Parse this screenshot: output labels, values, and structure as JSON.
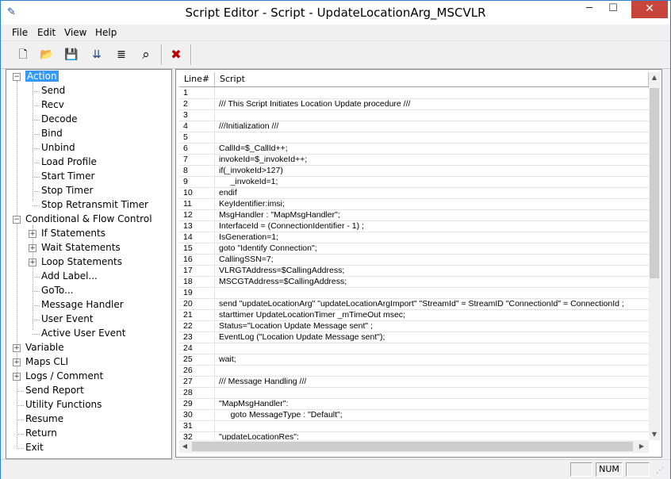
{
  "window": {
    "title": "Script Editor - Script - UpdateLocationArg_MSCVLR",
    "minimize": "─",
    "maximize": "☐",
    "close": "✕"
  },
  "menu": [
    "File",
    "Edit",
    "View",
    "Help"
  ],
  "toolbar": {
    "buttons": [
      {
        "name": "new-icon",
        "glyph": "🗋"
      },
      {
        "name": "open-folder-icon",
        "glyph": "📂"
      },
      {
        "name": "save-icon",
        "glyph": "💾"
      },
      {
        "name": "insert-icon",
        "glyph": "⇊"
      },
      {
        "name": "indent-icon",
        "glyph": "≣"
      },
      {
        "name": "find-icon",
        "glyph": "⌕"
      },
      {
        "name": "delete-icon",
        "glyph": "✖"
      }
    ]
  },
  "tree": {
    "items": [
      {
        "label": "Action",
        "level": 0,
        "expander": "−",
        "selected": true
      },
      {
        "label": "Send",
        "level": 1
      },
      {
        "label": "Recv",
        "level": 1
      },
      {
        "label": "Decode",
        "level": 1
      },
      {
        "label": "Bind",
        "level": 1
      },
      {
        "label": "Unbind",
        "level": 1
      },
      {
        "label": "Load Profile",
        "level": 1
      },
      {
        "label": "Start Timer",
        "level": 1
      },
      {
        "label": "Stop Timer",
        "level": 1
      },
      {
        "label": "Stop Retransmit Timer",
        "level": 1
      },
      {
        "label": "Conditional & Flow Control",
        "level": 0,
        "expander": "−"
      },
      {
        "label": "If Statements",
        "level": 1,
        "expander": "+"
      },
      {
        "label": "Wait Statements",
        "level": 1,
        "expander": "+"
      },
      {
        "label": "Loop Statements",
        "level": 1,
        "expander": "+"
      },
      {
        "label": "Add Label...",
        "level": 1
      },
      {
        "label": "GoTo...",
        "level": 1
      },
      {
        "label": "Message Handler",
        "level": 1
      },
      {
        "label": "User Event",
        "level": 1
      },
      {
        "label": "Active User Event",
        "level": 1
      },
      {
        "label": "Variable",
        "level": 0,
        "expander": "+"
      },
      {
        "label": "Maps CLI",
        "level": 0,
        "expander": "+"
      },
      {
        "label": "Logs / Comment",
        "level": 0,
        "expander": "+"
      },
      {
        "label": "Send Report",
        "level": 0
      },
      {
        "label": "Utility Functions",
        "level": 0
      },
      {
        "label": "Resume",
        "level": 0
      },
      {
        "label": "Return",
        "level": 0
      },
      {
        "label": "Exit",
        "level": 0
      }
    ]
  },
  "editor": {
    "columns": {
      "line": "Line#",
      "script": "Script"
    },
    "lines": [
      {
        "n": "1",
        "code": ""
      },
      {
        "n": "2",
        "code": "/// This Script Initiates Location Update procedure ///"
      },
      {
        "n": "3",
        "code": ""
      },
      {
        "n": "4",
        "code": "///Initialization ///"
      },
      {
        "n": "5",
        "code": ""
      },
      {
        "n": "6",
        "code": "CallId=$_CallId++;"
      },
      {
        "n": "7",
        "code": "invokeId=$_invokeId++;"
      },
      {
        "n": "8",
        "code": "if(_invokeId>127)"
      },
      {
        "n": "9",
        "code": "     _invokeId=1;"
      },
      {
        "n": "10",
        "code": "endif"
      },
      {
        "n": "11",
        "code": "KeyIdentifier:imsi;"
      },
      {
        "n": "12",
        "code": "MsgHandler : \"MapMsgHandler\";"
      },
      {
        "n": "13",
        "code": "InterfaceId = (ConnectionIdentifier - 1) ;"
      },
      {
        "n": "14",
        "code": "IsGeneration=1;"
      },
      {
        "n": "15",
        "code": "goto \"Identify Connection\";"
      },
      {
        "n": "16",
        "code": "CallingSSN=7;"
      },
      {
        "n": "17",
        "code": "VLRGTAddress=$CallingAddress;"
      },
      {
        "n": "18",
        "code": "MSCGTAddress=$CallingAddress;"
      },
      {
        "n": "19",
        "code": ""
      },
      {
        "n": "20",
        "code": "send \"updateLocationArg\" \"updateLocationArgImport\" \"StreamId\" = StreamID \"ConnectionId\" = ConnectionId ;"
      },
      {
        "n": "21",
        "code": "starttimer UpdateLocationTimer _mTimeOut msec;"
      },
      {
        "n": "22",
        "code": "Status=\"Location Update Message sent\" ;"
      },
      {
        "n": "23",
        "code": "EventLog (\"Location Update Message sent\");"
      },
      {
        "n": "24",
        "code": ""
      },
      {
        "n": "25",
        "code": "wait;"
      },
      {
        "n": "26",
        "code": ""
      },
      {
        "n": "27",
        "code": "/// Message Handling ///"
      },
      {
        "n": "28",
        "code": ""
      },
      {
        "n": "29",
        "code": "\"MapMsgHandler\":"
      },
      {
        "n": "30",
        "code": "     goto MessageType : \"Default\";"
      },
      {
        "n": "31",
        "code": ""
      },
      {
        "n": "32",
        "code": "\"updateLocationRes\":"
      }
    ]
  },
  "scroll": {
    "up": "▲",
    "down": "▼",
    "left": "◀",
    "right": "▶"
  },
  "status": {
    "num": "NUM"
  },
  "colors": {
    "accent": "#3399ff",
    "close": "#c7453a",
    "delete": "#c00000"
  }
}
